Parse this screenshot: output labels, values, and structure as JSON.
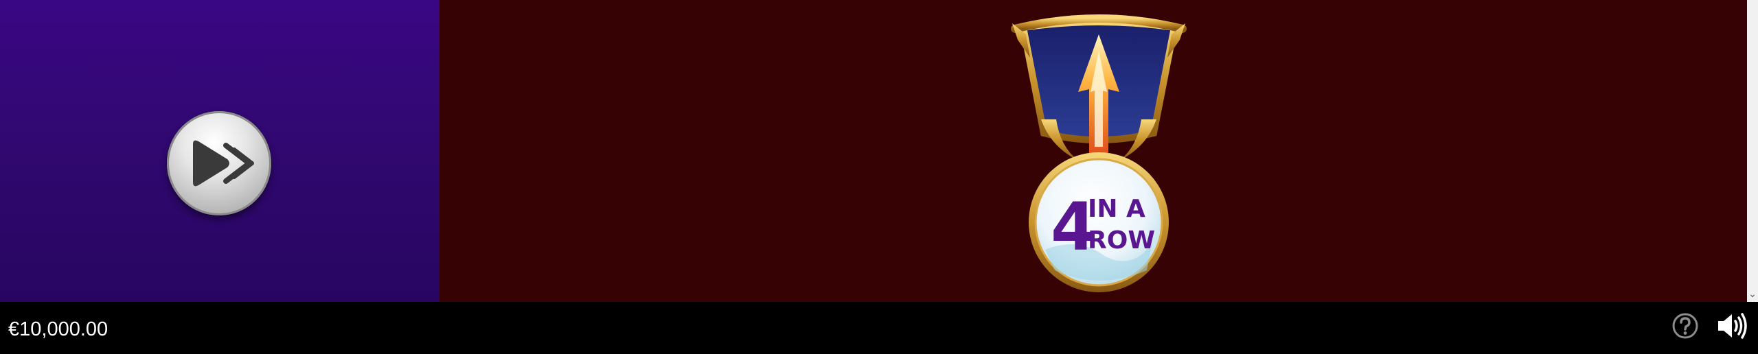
{
  "game": {
    "play_button_icon": "fast-forward-play-icon",
    "badge": {
      "number": "4",
      "line1": "IN A",
      "line2": "ROW",
      "accent": "#5a1590"
    }
  },
  "footer": {
    "balance": "€10,000.00",
    "help_icon": "question-circle-icon",
    "sound_icon": "speaker-volume-icon"
  },
  "colors": {
    "left_panel": "#30086f",
    "right_panel": "#360204",
    "bottom_bar": "#000000"
  }
}
